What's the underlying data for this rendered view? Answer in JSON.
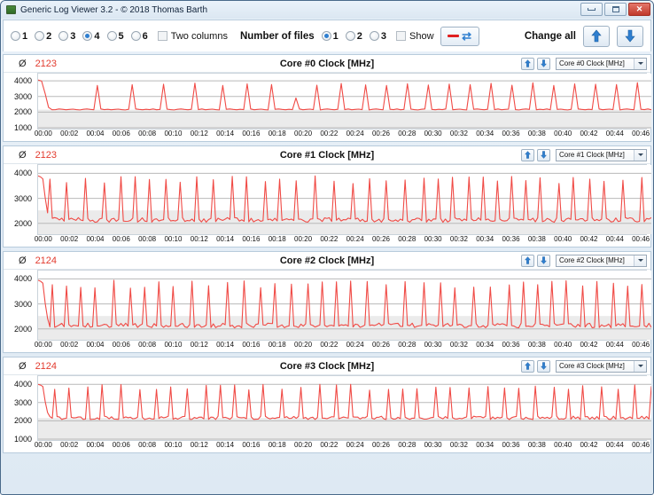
{
  "window": {
    "title": "Generic Log Viewer 3.2 - © 2018 Thomas Barth",
    "icon": "app-icon",
    "buttons": {
      "minimize": "–",
      "maximize": "□",
      "close": "✕"
    }
  },
  "toolbar": {
    "column_options": [
      {
        "label": "1",
        "selected": false
      },
      {
        "label": "2",
        "selected": false
      },
      {
        "label": "3",
        "selected": false
      },
      {
        "label": "4",
        "selected": true
      },
      {
        "label": "5",
        "selected": false
      },
      {
        "label": "6",
        "selected": false
      }
    ],
    "two_columns_label": "Two columns",
    "two_columns_checked": false,
    "number_of_files_label": "Number of files",
    "file_options": [
      {
        "label": "1",
        "selected": true
      },
      {
        "label": "2",
        "selected": false
      },
      {
        "label": "3",
        "selected": false
      }
    ],
    "show_label": "Show",
    "show_checked": false,
    "show_button": {
      "dash": "—",
      "swap": "⇄"
    },
    "change_all_label": "Change all",
    "up_button": "up-arrow",
    "down_button": "down-arrow"
  },
  "accent": {
    "line": "#f04a45",
    "value_text": "#e23b2e",
    "blue": "#2f7fd0",
    "band": "#f4f4f4",
    "band_dark": "#e8e8e8"
  },
  "chart_data": [
    {
      "type": "line",
      "title": "Core #0 Clock [MHz]",
      "average_symbol": "Ø",
      "average_value": "2123",
      "series_selector": "Core #0 Clock [MHz]",
      "xlabel": "",
      "ylabel": "",
      "ylim": [
        1000,
        4400
      ],
      "yticks": [
        1000,
        2000,
        3000,
        4000
      ],
      "grid": true,
      "legend": "none",
      "xticks": [
        "00:00",
        "00:02",
        "00:04",
        "00:06",
        "00:08",
        "00:10",
        "00:12",
        "00:14",
        "00:16",
        "00:18",
        "00:20",
        "00:22",
        "00:24",
        "00:26",
        "00:28",
        "00:30",
        "00:32",
        "00:34",
        "00:36",
        "00:38",
        "00:40",
        "00:42",
        "00:44",
        "00:46"
      ],
      "baseline": 2150,
      "peak": 4050,
      "values": [
        4050,
        3980,
        3200,
        2300,
        2150,
        2160,
        2200,
        2180,
        2150,
        2170,
        2190,
        2160,
        2140,
        2180,
        2200,
        2170,
        2150,
        3700,
        2200,
        2160,
        2180,
        2150,
        2170,
        2190,
        2160,
        2140,
        2180,
        3750,
        2200,
        2170,
        2150,
        2180,
        2160,
        2200,
        2150,
        2170,
        3780,
        2190,
        2160,
        2140,
        2180,
        2200,
        2170,
        2150,
        2180,
        3850,
        2160,
        2200,
        2150,
        2170,
        2190,
        2160,
        2140,
        3700,
        2180,
        2200,
        2170,
        2150,
        2180,
        2160,
        3800,
        2200,
        2150,
        2170,
        2190,
        2160,
        2140,
        3760,
        2180,
        2200,
        2170,
        2150,
        2180,
        2160,
        2900,
        2200,
        2150,
        2170,
        2190,
        2160,
        3720,
        2140,
        2180,
        2200,
        2170,
        2150,
        2180,
        3830,
        2160,
        2200,
        2150,
        2170,
        2190,
        2160,
        3740,
        2140,
        2180,
        2200,
        2170,
        2150,
        3700,
        2180,
        2160,
        2200,
        2150,
        2170,
        3810,
        2190,
        2160,
        2140,
        2180,
        2200,
        3730,
        2170,
        2150,
        2180,
        2160,
        2200,
        3790,
        2150,
        2170,
        2190,
        2160,
        2140,
        3750,
        2180,
        2200,
        2170,
        2150,
        2180,
        3840,
        2160,
        2200,
        2150,
        2170,
        2190,
        3720,
        2160,
        2140,
        2180,
        2200,
        2170,
        3870,
        2150,
        2180,
        2160,
        2200,
        2150,
        3700,
        2170,
        2190,
        2160,
        2140,
        2180,
        3800,
        2200,
        2170,
        2150,
        2180,
        2160,
        3780,
        2200,
        2150,
        2170,
        2190,
        2160,
        3760,
        2140,
        2180,
        2200,
        2170,
        2150,
        3880,
        2180,
        2160,
        2200,
        2150
      ]
    },
    {
      "type": "line",
      "title": "Core #1 Clock [MHz]",
      "average_symbol": "Ø",
      "average_value": "2123",
      "series_selector": "Core #1 Clock [MHz]",
      "xlabel": "",
      "ylabel": "",
      "ylim": [
        1600,
        4300
      ],
      "yticks": [
        2000,
        3000,
        4000
      ],
      "grid": true,
      "legend": "none",
      "xticks": [
        "00:00",
        "00:02",
        "00:04",
        "00:06",
        "00:08",
        "00:10",
        "00:12",
        "00:14",
        "00:16",
        "00:18",
        "00:20",
        "00:22",
        "00:24",
        "00:26",
        "00:28",
        "00:30",
        "00:32",
        "00:34",
        "00:36",
        "00:38",
        "00:40",
        "00:42",
        "00:44",
        "00:46"
      ],
      "baseline": 2120,
      "peak": 3900
    },
    {
      "type": "line",
      "title": "Core #2 Clock [MHz]",
      "average_symbol": "Ø",
      "average_value": "2124",
      "series_selector": "Core #2 Clock [MHz]",
      "xlabel": "",
      "ylabel": "",
      "ylim": [
        1600,
        4300
      ],
      "yticks": [
        2000,
        3000,
        4000
      ],
      "grid": true,
      "legend": "none",
      "xticks": [
        "00:00",
        "00:02",
        "00:04",
        "00:06",
        "00:08",
        "00:10",
        "00:12",
        "00:14",
        "00:16",
        "00:18",
        "00:20",
        "00:22",
        "00:24",
        "00:26",
        "00:28",
        "00:30",
        "00:32",
        "00:34",
        "00:36",
        "00:38",
        "00:40",
        "00:42",
        "00:44",
        "00:46"
      ],
      "baseline": 2120,
      "peak": 3950
    },
    {
      "type": "line",
      "title": "Core #3 Clock [MHz]",
      "average_symbol": "Ø",
      "average_value": "2124",
      "series_selector": "Core #3 Clock [MHz]",
      "xlabel": "",
      "ylabel": "",
      "ylim": [
        1000,
        4400
      ],
      "yticks": [
        1000,
        2000,
        3000,
        4000
      ],
      "grid": true,
      "legend": "none",
      "xticks": [
        "00:00",
        "00:02",
        "00:04",
        "00:06",
        "00:08",
        "00:10",
        "00:12",
        "00:14",
        "00:16",
        "00:18",
        "00:20",
        "00:22",
        "00:24",
        "00:26",
        "00:28",
        "00:30",
        "00:32",
        "00:34",
        "00:36",
        "00:38",
        "00:40",
        "00:42",
        "00:44",
        "00:46"
      ],
      "baseline": 2150,
      "peak": 4000
    }
  ]
}
